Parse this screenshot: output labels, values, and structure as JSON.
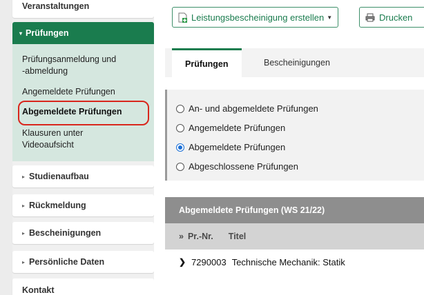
{
  "sidebar": {
    "top_cut_item": "Veranstaltungen",
    "active_section": "Prüfungen",
    "submenu": [
      {
        "label_line1": "Prüfungsanmeldung und",
        "label_line2": "-abmeldung"
      },
      {
        "label_line1": "Angemeldete Prüfungen"
      },
      {
        "label_line1": "Abgemeldete Prüfungen"
      },
      {
        "label_line1": "Klausuren unter",
        "label_line2": "Videoaufsicht"
      }
    ],
    "items": [
      {
        "label": "Studienaufbau"
      },
      {
        "label": "Rückmeldung"
      },
      {
        "label": "Bescheinigungen"
      },
      {
        "label": "Persönliche Daten"
      },
      {
        "label": "Kontakt"
      }
    ]
  },
  "toolbar": {
    "certificate_label": "Leistungsbescheinigung erstellen",
    "print_label": "Drucken"
  },
  "tabs": [
    {
      "label": "Prüfungen",
      "active": true
    },
    {
      "label": "Bescheinigungen",
      "active": false
    }
  ],
  "filter": {
    "options": [
      {
        "label": "An- und abgemeldete Prüfungen",
        "checked": false
      },
      {
        "label": "Angemeldete Prüfungen",
        "checked": false
      },
      {
        "label": "Abgemeldete Prüfungen",
        "checked": true
      },
      {
        "label": "Abgeschlossene Prüfungen",
        "checked": false
      }
    ]
  },
  "results": {
    "header": "Abgemeldete Prüfungen (WS 21/22)",
    "columns": {
      "expand": "»",
      "nr": "Pr.-Nr.",
      "title": "Titel"
    },
    "rows": [
      {
        "nr": "7290003",
        "title": "Technische Mechanik: Statik"
      }
    ]
  },
  "colors": {
    "accent": "#1a7c4e",
    "submenu_bg": "#d5e7df",
    "highlight_ring": "#d9261c",
    "radio_checked": "#1a6fd6"
  }
}
